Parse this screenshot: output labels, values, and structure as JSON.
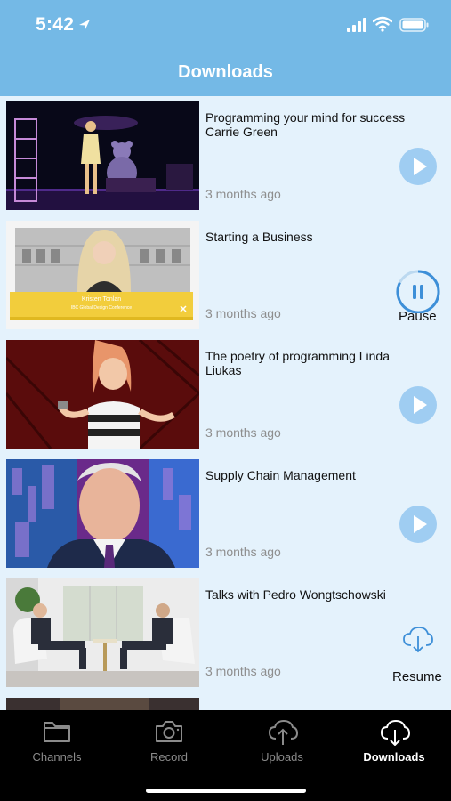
{
  "status_bar": {
    "time": "5:42"
  },
  "header": {
    "title": "Downloads"
  },
  "downloads": [
    {
      "title": "Programming your mind for success Carrie Green",
      "age": "3 months ago",
      "action": "play"
    },
    {
      "title": "Starting a Business",
      "age": "3 months ago",
      "action": "pause",
      "action_label": "Pause",
      "thumb_caption_name": "Kristen Tonlan",
      "thumb_caption_sub": "IBC Global Design Conference"
    },
    {
      "title": "The poetry of programming Linda Liukas",
      "age": "3 months ago",
      "action": "play"
    },
    {
      "title": "Supply Chain Management",
      "age": "3 months ago",
      "action": "play"
    },
    {
      "title": "Talks with Pedro Wongtschowski",
      "age": "3 months ago",
      "action": "resume",
      "action_label": "Resume"
    }
  ],
  "tabbar": {
    "tabs": [
      {
        "label": "Channels",
        "icon": "folder-icon",
        "active": false
      },
      {
        "label": "Record",
        "icon": "camera-icon",
        "active": false
      },
      {
        "label": "Uploads",
        "icon": "cloud-upload-icon",
        "active": false
      },
      {
        "label": "Downloads",
        "icon": "cloud-download-icon",
        "active": true
      }
    ]
  },
  "colors": {
    "header": "#74b9e6",
    "background": "#e4f2fc",
    "accent": "#3d8fd8",
    "play": "#9fcdf2",
    "tabbar": "#000000"
  }
}
